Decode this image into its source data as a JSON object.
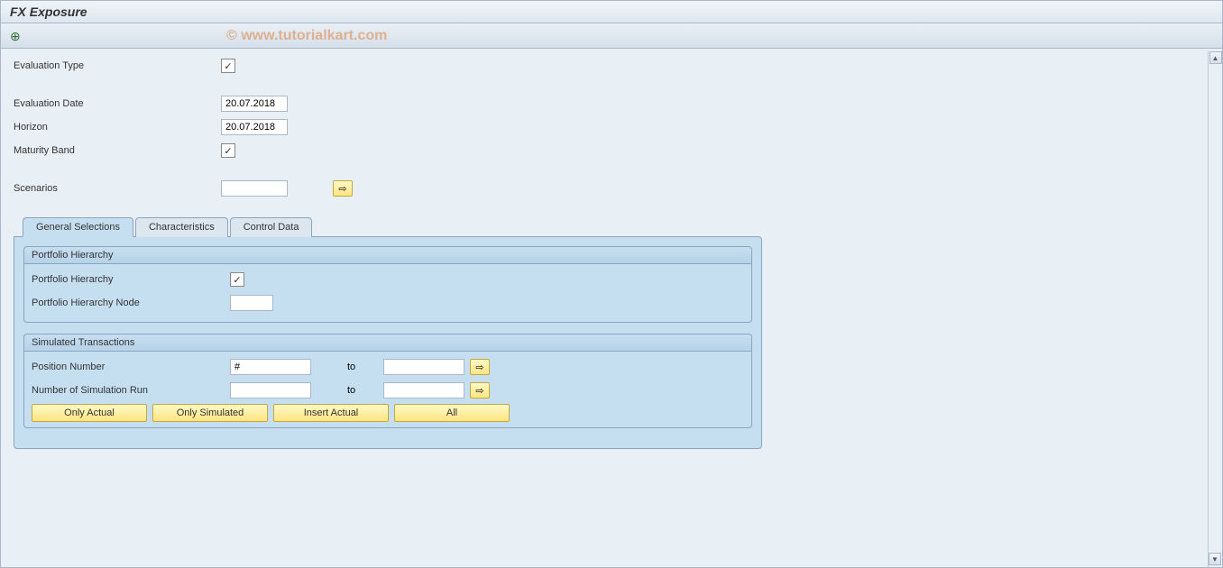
{
  "window": {
    "title": "FX Exposure"
  },
  "watermark": "© www.tutorialkart.com",
  "fields": {
    "evaluation_type": {
      "label": "Evaluation Type",
      "checked": true
    },
    "evaluation_date": {
      "label": "Evaluation Date",
      "value": "20.07.2018"
    },
    "horizon": {
      "label": "Horizon",
      "value": "20.07.2018"
    },
    "maturity_band": {
      "label": "Maturity Band",
      "checked": true
    },
    "scenarios": {
      "label": "Scenarios",
      "value": ""
    }
  },
  "tabs": {
    "general": "General Selections",
    "characteristics": "Characteristics",
    "control": "Control Data"
  },
  "groups": {
    "portfolio": {
      "title": "Portfolio Hierarchy",
      "hierarchy_label": "Portfolio Hierarchy",
      "hierarchy_checked": true,
      "node_label": "Portfolio Hierarchy Node",
      "node_value": ""
    },
    "simulated": {
      "title": "Simulated Transactions",
      "position_label": "Position Number",
      "position_from": "#",
      "position_to": "",
      "to_label": "to",
      "runs_label": "Number of Simulation Run",
      "runs_from": "",
      "runs_to": "",
      "buttons": {
        "only_actual": "Only Actual",
        "only_simulated": "Only Simulated",
        "insert_actual": "Insert Actual",
        "all": "All"
      }
    }
  },
  "icons": {
    "arrow_right": "⇨",
    "check": "✓",
    "execute": "⊕",
    "up": "▲",
    "down": "▼"
  }
}
